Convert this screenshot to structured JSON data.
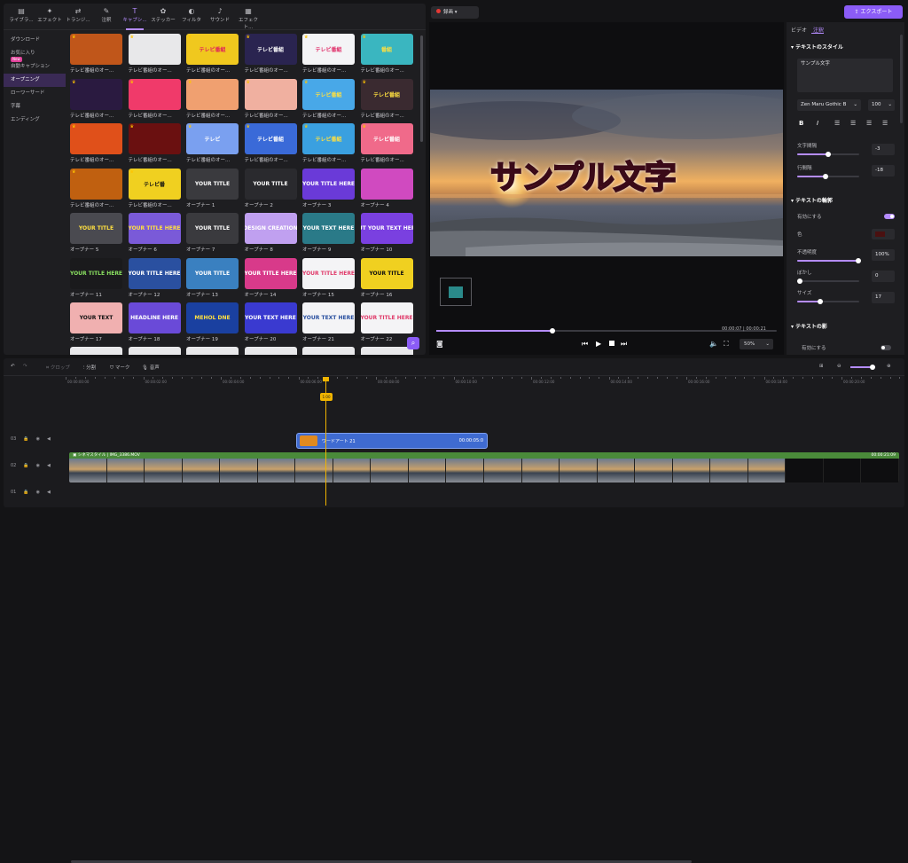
{
  "library": {
    "tabs": [
      {
        "icon": "library-icon",
        "label": "ライブラ..."
      },
      {
        "icon": "effect-icon",
        "label": "エフェクト"
      },
      {
        "icon": "transition-icon",
        "label": "トランジ..."
      },
      {
        "icon": "annotation-icon",
        "label": "注釈"
      },
      {
        "icon": "caption-icon",
        "label": "キャプシ..."
      },
      {
        "icon": "sticker-icon",
        "label": "ステッカー"
      },
      {
        "icon": "filter-icon",
        "label": "フィルタ"
      },
      {
        "icon": "sound-icon",
        "label": "サウンド"
      },
      {
        "icon": "effect-pack-icon",
        "label": "エフェクト..."
      }
    ],
    "categories": [
      "ダウンロード",
      "お気に入り",
      "自動キャプション",
      "オープニング",
      "ローワーサード",
      "字幕",
      "エンディング"
    ],
    "new_badge": "New",
    "cards": [
      {
        "label": "テレビ番組のオー...",
        "title": "",
        "bg": "#c0561a",
        "fg": "#ffd23a"
      },
      {
        "label": "テレビ番組のオー...",
        "title": "",
        "bg": "#e8e8ea",
        "fg": "#3aa84a"
      },
      {
        "label": "テレビ番組のオー...",
        "title": "テレビ番組",
        "bg": "#f0c81e",
        "fg": "#e0245a"
      },
      {
        "label": "テレビ番組のオー...",
        "title": "テレビ番組",
        "bg": "#2a2450",
        "fg": "#ffffff"
      },
      {
        "label": "テレビ番組のオー...",
        "title": "テレビ番組",
        "bg": "#f4f4f6",
        "fg": "#e0306a"
      },
      {
        "label": "テレビ番組のオー...",
        "title": "番組",
        "bg": "#3ab6c0",
        "fg": "#ffe040"
      },
      {
        "label": "テレビ番組のオー...",
        "title": "",
        "bg": "#2a1a40",
        "fg": "#ff9a2a"
      },
      {
        "label": "テレビ番組のオー...",
        "title": "",
        "bg": "#f03a6a",
        "fg": "#ffe04a"
      },
      {
        "label": "テレビ番組のオー...",
        "title": "",
        "bg": "#f0a070",
        "fg": "#ffffff"
      },
      {
        "label": "テレビ番組のオー...",
        "title": "",
        "bg": "#f0b0a0",
        "fg": "#3a8ac0"
      },
      {
        "label": "テレビ番組のオー...",
        "title": "テレビ番組",
        "bg": "#48a8e8",
        "fg": "#ffe040"
      },
      {
        "label": "テレビ番組のオー...",
        "title": "テレビ番組",
        "bg": "#3a2a30",
        "fg": "#ffe040"
      },
      {
        "label": "テレビ番組のオー...",
        "title": "",
        "bg": "#e0501a",
        "fg": "#ffd23a"
      },
      {
        "label": "テレビ番組のオー...",
        "title": "",
        "bg": "#6a1010",
        "fg": "#ffc020"
      },
      {
        "label": "テレビ番組のオー...",
        "title": "テレビ",
        "bg": "#7aa0f0",
        "fg": "#ffffff"
      },
      {
        "label": "テレビ番組のオー...",
        "title": "テレビ番組",
        "bg": "#3a6ad8",
        "fg": "#ffffff"
      },
      {
        "label": "テレビ番組のオー...",
        "title": "テレビ番組",
        "bg": "#3aa0e0",
        "fg": "#ffe040"
      },
      {
        "label": "テレビ番組のオー...",
        "title": "テレビ番組",
        "bg": "#f06a8a",
        "fg": "#ffffff"
      },
      {
        "label": "テレビ番組のオー...",
        "title": "",
        "bg": "#c06010",
        "fg": "#ffd040"
      },
      {
        "label": "テレビ番組のオー...",
        "title": "テレビ番",
        "bg": "#f0d020",
        "fg": "#111111"
      },
      {
        "label": "オープナー 1",
        "title": "YOUR TITLE",
        "bg": "#3a3a3e",
        "fg": "#ffffff"
      },
      {
        "label": "オープナー 2",
        "title": "YOUR TITLE",
        "bg": "#2a2a2e",
        "fg": "#ffffff"
      },
      {
        "label": "オープナー 3",
        "title": "YOUR TITLE HERE",
        "bg": "#6a3ad8",
        "fg": "#ffffff"
      },
      {
        "label": "オープナー 4",
        "title": "",
        "bg": "#d04ac0",
        "fg": "#ffffff"
      },
      {
        "label": "オープナー 5",
        "title": "YOUR TITLE",
        "bg": "#4a4a50",
        "fg": "#ffe040"
      },
      {
        "label": "オープナー 6",
        "title": "YOUR TITLE HERE",
        "bg": "#7a5ad8",
        "fg": "#ffe040"
      },
      {
        "label": "オープナー 7",
        "title": "YOUR TITLE",
        "bg": "#3a3a3e",
        "fg": "#ffffff"
      },
      {
        "label": "オープナー 8",
        "title": "DESIGN CREATION",
        "bg": "#c0a0f0",
        "fg": "#ffffff"
      },
      {
        "label": "オープナー 9",
        "title": "YOUR TEXT HERE",
        "bg": "#2a7a88",
        "fg": "#ffffff"
      },
      {
        "label": "オープナー 10",
        "title": "PUT YOUR TEXT HERE",
        "bg": "#7a40e0",
        "fg": "#ffffff"
      },
      {
        "label": "オープナー 11",
        "title": "YOUR TITLE HERE",
        "bg": "#1a1a1c",
        "fg": "#8ae060"
      },
      {
        "label": "オープナー 12",
        "title": "YOUR TITLE HERE",
        "bg": "#2a50a0",
        "fg": "#ffffff"
      },
      {
        "label": "オープナー 13",
        "title": "YOUR TITLE",
        "bg": "#3a80c0",
        "fg": "#ffffff"
      },
      {
        "label": "オープナー 14",
        "title": "YOUR TITLE HERE",
        "bg": "#d83a8a",
        "fg": "#ffffff"
      },
      {
        "label": "オープナー 15",
        "title": "YOUR TITLE HERE",
        "bg": "#f4f4f6",
        "fg": "#e03a6a"
      },
      {
        "label": "オープナー 16",
        "title": "YOUR TITLE",
        "bg": "#f0d020",
        "fg": "#111111"
      },
      {
        "label": "オープナー 17",
        "title": "YOUR TEXT",
        "bg": "#f0b0b0",
        "fg": "#111111"
      },
      {
        "label": "オープナー 18",
        "title": "HEADLINE HERE",
        "bg": "#6a4ad8",
        "fg": "#ffffff"
      },
      {
        "label": "オープナー 19",
        "title": "MEHOL DNE",
        "bg": "#1a40a0",
        "fg": "#ffe040"
      },
      {
        "label": "オープナー 20",
        "title": "YOUR TEXT HERE",
        "bg": "#3a3ad0",
        "fg": "#ffffff"
      },
      {
        "label": "オープナー 21",
        "title": "YOUR TEXT HERE",
        "bg": "#f4f4f6",
        "fg": "#2a50a0"
      },
      {
        "label": "オープナー 22",
        "title": "YOUR TITLE HERE",
        "bg": "#f4f4f6",
        "fg": "#e03a6a"
      }
    ]
  },
  "preview": {
    "record_label": "録画",
    "export_label": "エクスポート",
    "overlay_text": "サンプル文字",
    "time_current": "00:00:07",
    "time_total": "00:00:21",
    "zoom": "50%",
    "progress": 0.34
  },
  "props": {
    "tabs": [
      "ビデオ",
      "注釈"
    ],
    "text_style_title": "テキストのスタイル",
    "text_value": "サンプル文字",
    "font": "Zen Maru Gothic B",
    "font_size": "100",
    "letter_spacing_label": "文字間隔",
    "letter_spacing": "-3",
    "line_spacing_label": "行間隔",
    "line_spacing": "-18",
    "outline_title": "テキストの輪郭",
    "enable_label": "有効にする",
    "color_label": "色",
    "opacity_label": "不透明度",
    "opacity": "100%",
    "blur_label": "ぼかし",
    "blur": "0",
    "size_label": "サイズ",
    "size": "17",
    "shadow_title": "テキストの影",
    "shadow_enable_label": "有効にする",
    "accent": "#b58cff"
  },
  "timeline": {
    "tools": [
      "クロップ",
      "分割",
      "マーク",
      "音声"
    ],
    "playhead_time": "1:00",
    "ruler": [
      "00:00:00:00",
      "00:00:02:00",
      "00:00:04:00",
      "00:00:06:00",
      "00:00:08:00",
      "00:00:10:00",
      "00:00:12:00",
      "00:00:14:00",
      "00:00:16:00",
      "00:00:18:00",
      "00:00:20:00"
    ],
    "tracks": [
      "03",
      "02",
      "01"
    ],
    "clip_text": {
      "name": "ワードアート 21",
      "duration": "00:00:05:0"
    },
    "clip_video": {
      "name": "シネマスタイル",
      "file": "IMG_3386.MOV",
      "duration": "00:00:21:09"
    }
  }
}
